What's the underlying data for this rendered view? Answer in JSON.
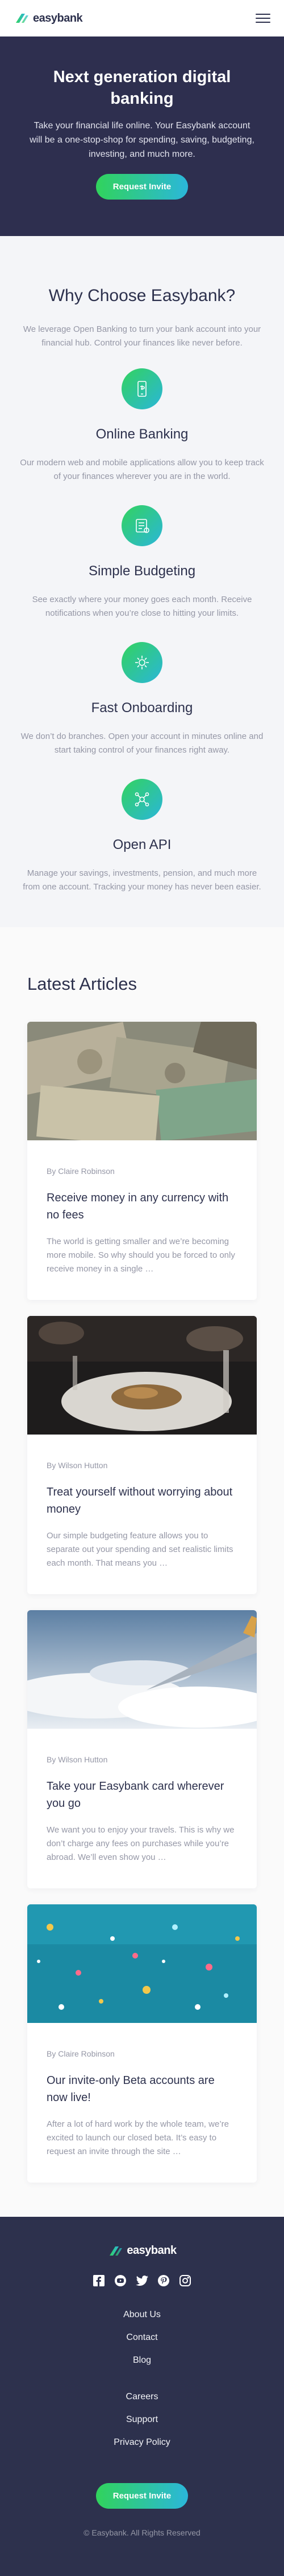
{
  "brand": {
    "name": "easybank",
    "colors": {
      "navy": "#2d314d",
      "green": "#31d35c",
      "cyan": "#2bb7da",
      "gray": "#9597a6"
    }
  },
  "hero": {
    "title": "Next generation digital banking",
    "text": "Take your financial life online. Your Easybank account will be a one-stop-shop for spending, saving, budgeting, investing, and much more.",
    "cta": "Request Invite"
  },
  "why": {
    "title": "Why Choose Easybank?",
    "lead": "We leverage Open Banking to turn your bank account into your financial hub. Control your finances like never before.",
    "features": [
      {
        "icon": "online-banking-icon",
        "title": "Online Banking",
        "text": "Our modern web and mobile applications allow you to keep track of your finances wherever you are in the world."
      },
      {
        "icon": "budgeting-icon",
        "title": "Simple Budgeting",
        "text": "See exactly where your money goes each month. Receive notifications when you’re close to hitting your limits."
      },
      {
        "icon": "onboarding-icon",
        "title": "Fast Onboarding",
        "text": "We don’t do branches. Open your account in minutes online and start taking control of your finances right away."
      },
      {
        "icon": "api-icon",
        "title": "Open API",
        "text": "Manage your savings, investments, pension, and much more from one account. Tracking your money has never been easier."
      }
    ]
  },
  "articles": {
    "title": "Latest Articles",
    "items": [
      {
        "author": "By Claire Robinson",
        "title": "Receive money in any currency with no fees",
        "text": "The world is getting smaller and we’re becoming more mobile. So why should you be forced to only receive money in a single …"
      },
      {
        "author": "By Wilson Hutton",
        "title": "Treat yourself without worrying about money",
        "text": "Our simple budgeting feature allows you to separate out your spending and set realistic limits each month. That means you …"
      },
      {
        "author": "By Wilson Hutton",
        "title": "Take your Easybank card wherever you go",
        "text": "We want you to enjoy your travels. This is why we don’t charge any fees on purchases while you’re abroad. We’ll even show you …"
      },
      {
        "author": "By Claire Robinson",
        "title": "Our invite-only Beta accounts are now live!",
        "text": "After a lot of hard work by the whole team, we’re excited to launch our closed beta. It’s easy to request an invite through the site …"
      }
    ]
  },
  "footer": {
    "socials": [
      "facebook-icon",
      "youtube-icon",
      "twitter-icon",
      "pinterest-icon",
      "instagram-icon"
    ],
    "links1": [
      "About Us",
      "Contact",
      "Blog"
    ],
    "links2": [
      "Careers",
      "Support",
      "Privacy Policy"
    ],
    "cta": "Request Invite",
    "copyright": "© Easybank. All Rights Reserved"
  }
}
